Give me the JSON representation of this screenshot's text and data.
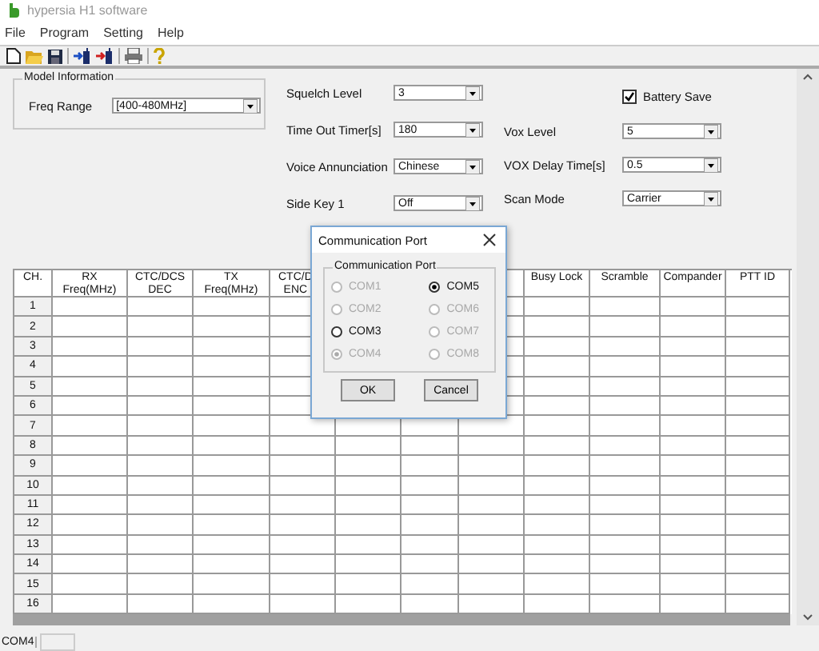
{
  "window": {
    "title": "hypersia H1 software"
  },
  "menu": [
    {
      "label": "File"
    },
    {
      "label": "Program"
    },
    {
      "label": "Setting"
    },
    {
      "label": "Help"
    }
  ],
  "model_information": {
    "title": "Model Information",
    "label": "Freq Range",
    "value": "[400-480MHz]"
  },
  "settings_left": [
    {
      "label": "Squelch Level",
      "value": "3"
    },
    {
      "label": "Time Out Timer[s]",
      "value": "180"
    },
    {
      "label": "Voice Annunciation",
      "value": "Chinese"
    },
    {
      "label": "Side Key 1",
      "value": "Off"
    }
  ],
  "battery_save": {
    "label": "Battery Save",
    "checked": true
  },
  "settings_right": [
    {
      "label": "Vox Level",
      "value": "5"
    },
    {
      "label": "VOX Delay Time[s]",
      "value": "0.5"
    },
    {
      "label": "Scan Mode",
      "value": "Carrier"
    }
  ],
  "table": {
    "columns": [
      {
        "label": "CH."
      },
      {
        "label": "RX",
        "sublabel": "Freq(MHz)"
      },
      {
        "label": "CTC/DCS",
        "sublabel": "DEC"
      },
      {
        "label": "TX",
        "sublabel": "Freq(MHz)"
      },
      {
        "label": "CTC/D",
        "sublabel": "ENC"
      },
      {},
      {},
      {},
      {
        "label": "Busy Lock"
      },
      {
        "label": "Scramble"
      },
      {
        "label": "Compander"
      },
      {
        "label": "PTT ID"
      }
    ],
    "rows": [
      "1",
      "2",
      "3",
      "4",
      "5",
      "6",
      "7",
      "8",
      "9",
      "10",
      "11",
      "12",
      "13",
      "14",
      "15",
      "16"
    ]
  },
  "dialog": {
    "title": "Communication Port",
    "group_title": "Communication Port",
    "ports": [
      {
        "label": "COM1",
        "selected": false,
        "disabled": true
      },
      {
        "label": "COM2",
        "selected": false,
        "disabled": true
      },
      {
        "label": "COM3",
        "selected": false,
        "disabled": false
      },
      {
        "label": "COM4",
        "selected": true,
        "disabled": true
      },
      {
        "label": "COM5",
        "selected": true,
        "disabled": false
      },
      {
        "label": "COM6",
        "selected": false,
        "disabled": true
      },
      {
        "label": "COM7",
        "selected": false,
        "disabled": true
      },
      {
        "label": "COM8",
        "selected": false,
        "disabled": true
      }
    ],
    "buttons": [
      "OK",
      "Cancel"
    ]
  },
  "status_bar": {
    "port": "COM4"
  }
}
